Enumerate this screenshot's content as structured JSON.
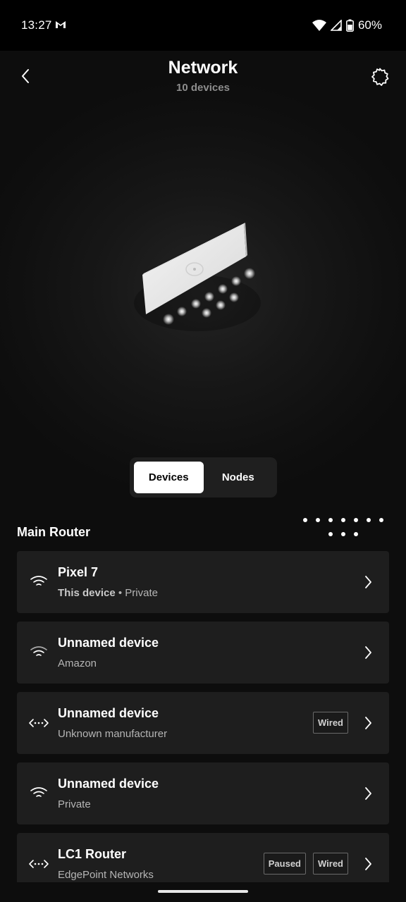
{
  "status_bar": {
    "time": "13:27",
    "battery": "60%",
    "icons": [
      "gmail-icon",
      "wifi-icon",
      "cellular-signal-icon",
      "battery-icon"
    ]
  },
  "header": {
    "title": "Network",
    "subtitle": "10 devices",
    "back_icon": "back-arrow-icon",
    "settings_icon": "gear-icon"
  },
  "tabs": {
    "devices_label": "Devices",
    "nodes_label": "Nodes",
    "selected": "Devices"
  },
  "section": {
    "title": "Main Router"
  },
  "devices": [
    {
      "name": "Pixel 7",
      "sub_strong": "This device",
      "sub_sep": " • ",
      "sub": "Private",
      "icon": "wifi-icon"
    },
    {
      "name": "Unnamed device",
      "sub": "Amazon",
      "icon": "wifi-icon"
    },
    {
      "name": "Unnamed device",
      "sub": "Unknown manufacturer",
      "icon": "ethernet-icon",
      "tags": [
        "Wired"
      ]
    },
    {
      "name": "Unnamed device",
      "sub": "Private",
      "icon": "wifi-icon"
    },
    {
      "name": "LC1 Router",
      "sub": "EdgePoint Networks",
      "icon": "ethernet-icon",
      "tags": [
        "Paused",
        "Wired"
      ]
    }
  ],
  "colors": {
    "background": "#0d0d0d",
    "card": "#1e1e1e",
    "accent": "#ffffff",
    "muted_text": "#8e8e8e"
  }
}
